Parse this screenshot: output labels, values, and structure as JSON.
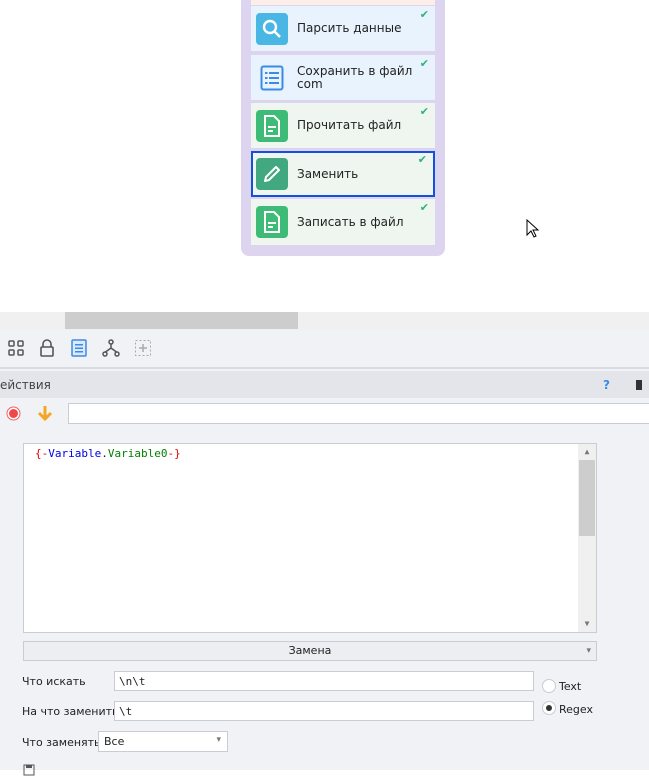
{
  "blocks": [
    {
      "label": "Парсить данные",
      "icon": "search-icon",
      "color": "#4ab6e3",
      "bg": "#e8f3fd"
    },
    {
      "label": "Сохранить в файл com",
      "icon": "list-icon",
      "color": "#e8f3fd",
      "bg": "#e8f3fd"
    },
    {
      "label": "Прочитать файл",
      "icon": "file-icon",
      "color": "#3dbb77",
      "bg": "#eef6ef"
    },
    {
      "label": "Заменить",
      "icon": "pencil-icon",
      "color": "#42a880",
      "bg": "#eef6ef"
    },
    {
      "label": "Записать в файл",
      "icon": "file-icon",
      "color": "#3dbb77",
      "bg": "#eef6ef"
    }
  ],
  "check": "✔",
  "panel": {
    "title": "ействия",
    "help": "?",
    "pin": "📌"
  },
  "editor": {
    "open": "{-",
    "var1": "Variable",
    "dot": ".",
    "var2": "Variable0",
    "close": "-}"
  },
  "mode": {
    "value": "Замена",
    "arrow": "▾"
  },
  "form": {
    "find_label": "Что искать",
    "find_value": "\\n\\t",
    "replace_label": "На что заменить",
    "replace_value": "\\t",
    "what_label": "Что заменять",
    "what_value": "Все",
    "radio_text": "Text",
    "radio_regex": "Regex",
    "selected": "Regex"
  }
}
